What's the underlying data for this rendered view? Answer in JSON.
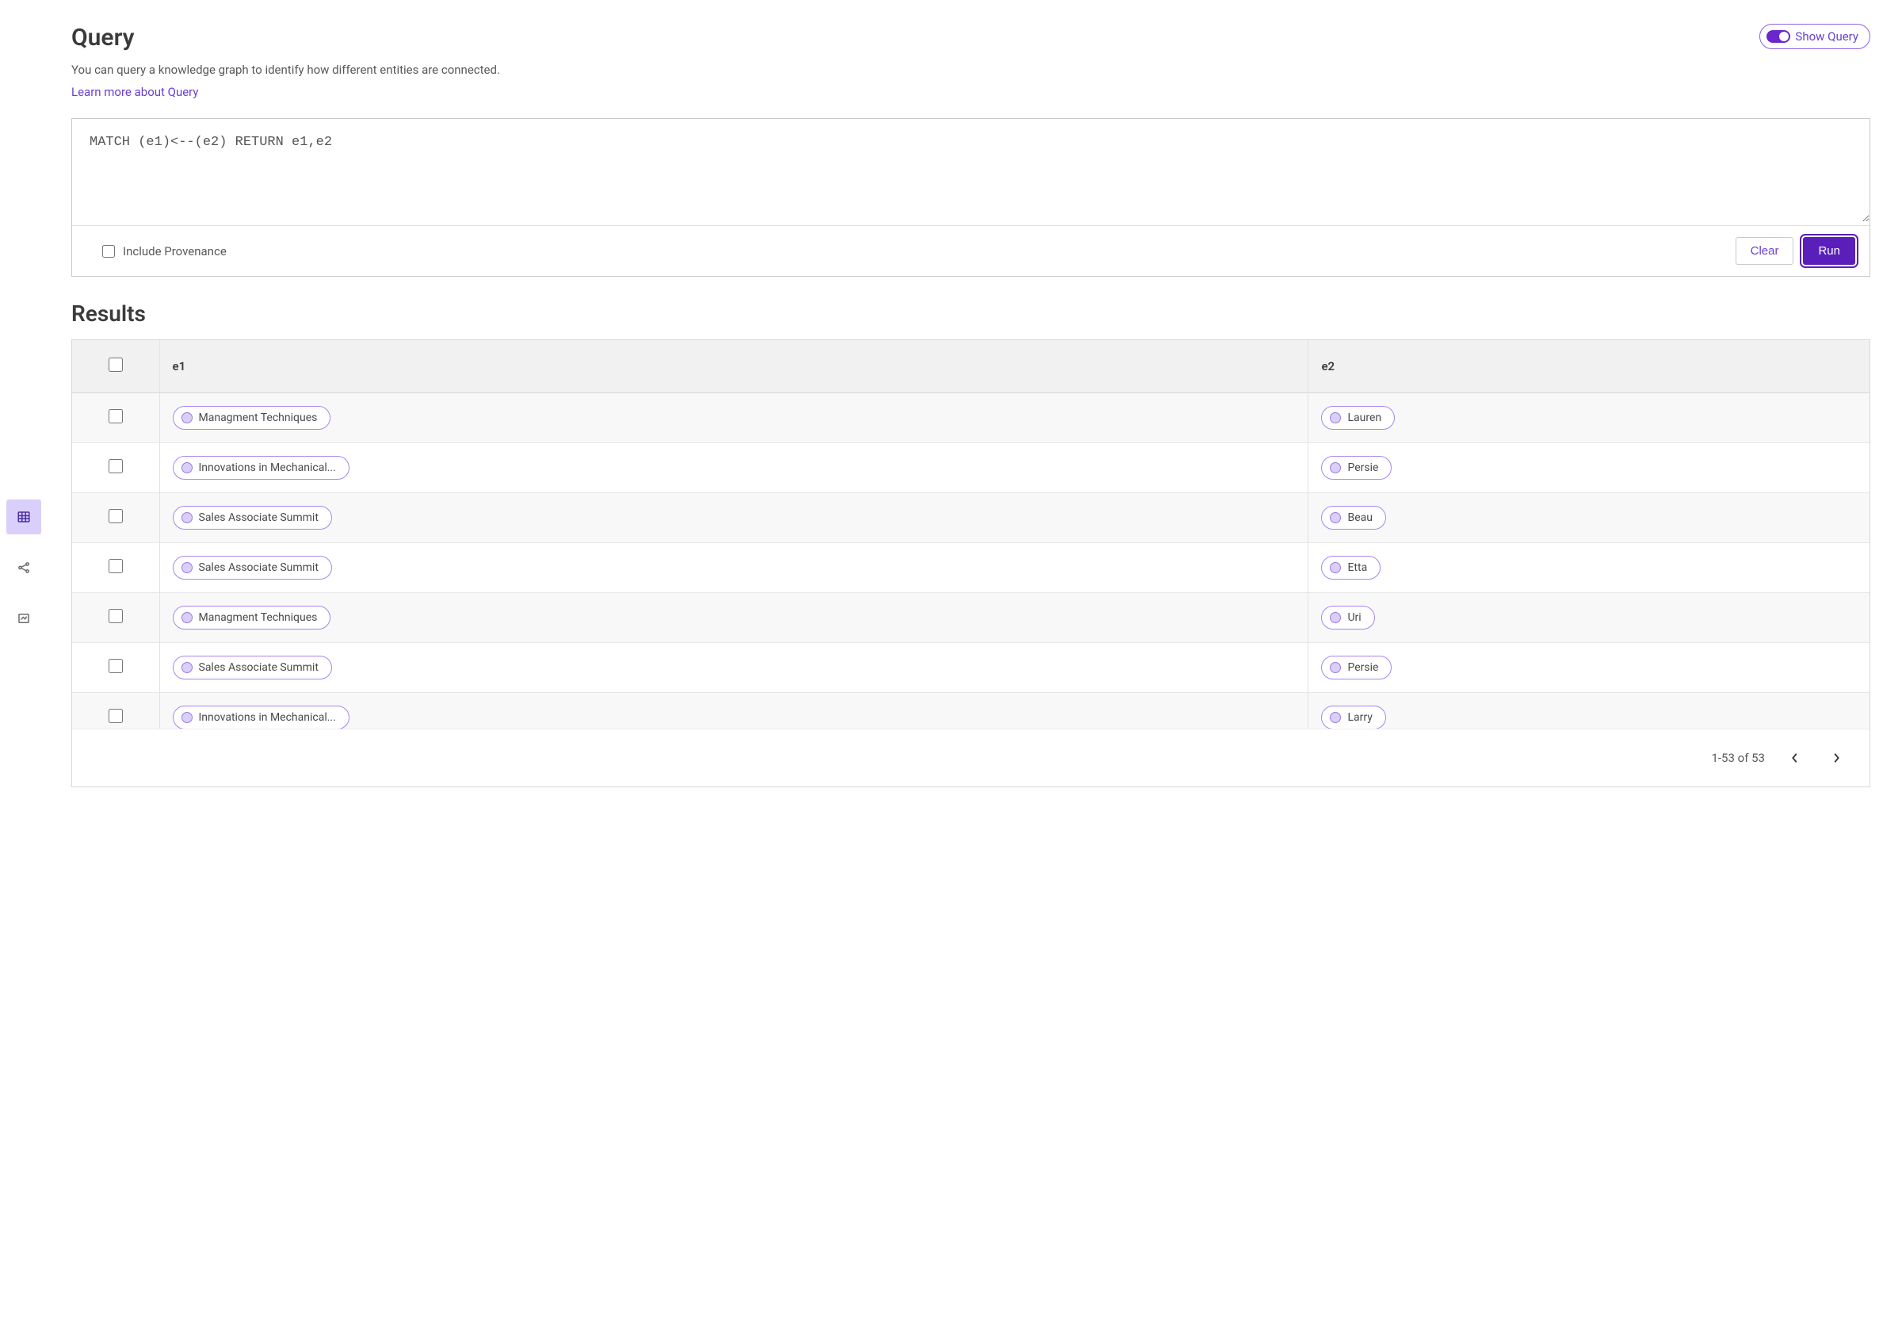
{
  "query": {
    "title": "Query",
    "description": "You can query a knowledge graph to identify how different entities are connected.",
    "learn_more": "Learn more about Query",
    "show_query_label": "Show Query",
    "query_text": "MATCH (e1)<--(e2) RETURN e1,e2",
    "include_provenance_label": "Include Provenance",
    "clear_label": "Clear",
    "run_label": "Run"
  },
  "results": {
    "title": "Results",
    "columns": {
      "e1": "e1",
      "e2": "e2"
    },
    "rows": [
      {
        "e1": "Managment Techniques",
        "e2": "Lauren"
      },
      {
        "e1": "Innovations in Mechanical...",
        "e2": "Persie"
      },
      {
        "e1": "Sales Associate Summit",
        "e2": "Beau"
      },
      {
        "e1": "Sales Associate Summit",
        "e2": "Etta"
      },
      {
        "e1": "Managment Techniques",
        "e2": "Uri"
      },
      {
        "e1": "Sales Associate Summit",
        "e2": "Persie"
      },
      {
        "e1": "Innovations in Mechanical...",
        "e2": "Larry"
      }
    ],
    "pager": "1-53 of 53"
  },
  "colors": {
    "accent": "#6a27c9",
    "pill_border": "#a786ef",
    "rail_active_bg": "#d9cffa"
  }
}
